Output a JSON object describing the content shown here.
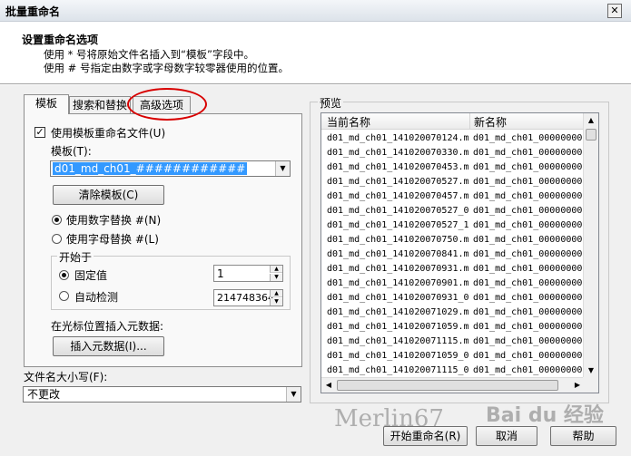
{
  "window": {
    "title": "批量重命名",
    "close_label": "✕"
  },
  "header": {
    "title": "设置重命名选项",
    "line1": "使用 * 号将原始文件名插入到“模板”字段中。",
    "line2": "使用 # 号指定由数字或字母数字较零器使用的位置。"
  },
  "tabs": [
    {
      "label": "模板",
      "active": true
    },
    {
      "label": "搜索和替换",
      "active": false
    },
    {
      "label": "高级选项",
      "active": false
    }
  ],
  "template_panel": {
    "use_template_label": "使用模板重命名文件(U)",
    "use_template_checked": true,
    "template_label": "模板(T):",
    "template_value": "d01_md_ch01_############",
    "clear_button": "清除模板(C)",
    "radio_number": "使用数字替换 #(N)",
    "radio_letter": "使用字母替换 #(L)",
    "radio_number_selected": true,
    "start_group": "开始于",
    "fixed_label": "固定值",
    "fixed_value": "1",
    "auto_label": "自动检测",
    "auto_value": "214748364",
    "fixed_selected": true,
    "insert_meta_label": "在光标位置插入元数据:",
    "insert_meta_button": "插入元数据(I)..."
  },
  "case_section": {
    "label": "文件名大小写(F):",
    "value": "不更改"
  },
  "preview": {
    "legend": "预览",
    "col_current": "当前名称",
    "col_new": "新名称",
    "rows": [
      [
        "d01_md_ch01_141020070124.m",
        "d01_md_ch01_00000000"
      ],
      [
        "d01_md_ch01_141020070330.m",
        "d01_md_ch01_00000000"
      ],
      [
        "d01_md_ch01_141020070453.m",
        "d01_md_ch01_00000000"
      ],
      [
        "d01_md_ch01_141020070527.m",
        "d01_md_ch01_00000000"
      ],
      [
        "d01_md_ch01_141020070457.m",
        "d01_md_ch01_00000000"
      ],
      [
        "d01_md_ch01_141020070527_0",
        "d01_md_ch01_00000000"
      ],
      [
        "d01_md_ch01_141020070527_1",
        "d01_md_ch01_00000000"
      ],
      [
        "d01_md_ch01_141020070750.m",
        "d01_md_ch01_00000000"
      ],
      [
        "d01_md_ch01_141020070841.m",
        "d01_md_ch01_00000000"
      ],
      [
        "d01_md_ch01_141020070931.m",
        "d01_md_ch01_00000000"
      ],
      [
        "d01_md_ch01_141020070901.m",
        "d01_md_ch01_00000000"
      ],
      [
        "d01_md_ch01_141020070931_0",
        "d01_md_ch01_00000000"
      ],
      [
        "d01_md_ch01_141020071029.m",
        "d01_md_ch01_00000000"
      ],
      [
        "d01_md_ch01_141020071059.m",
        "d01_md_ch01_00000000"
      ],
      [
        "d01_md_ch01_141020071115.m",
        "d01_md_ch01_00000000"
      ],
      [
        "d01_md_ch01_141020071059_0",
        "d01_md_ch01_00000000"
      ],
      [
        "d01_md_ch01_141020071115_0",
        "d01_md_ch01_00000000"
      ]
    ]
  },
  "buttons": {
    "start": "开始重命名(R)",
    "cancel": "取消",
    "help": "帮助"
  },
  "watermarks": {
    "author": "Merlin67",
    "site": "Bai du 经验"
  }
}
